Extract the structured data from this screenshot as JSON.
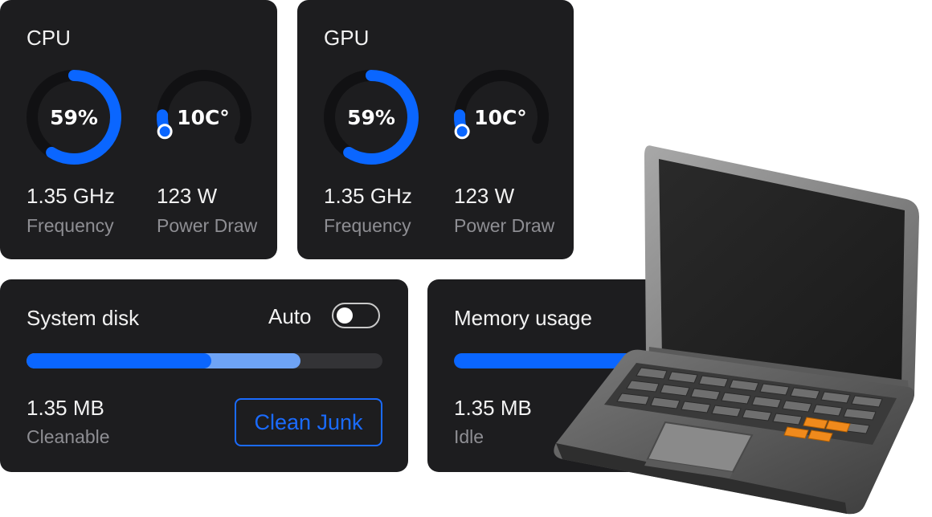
{
  "colors": {
    "accent": "#0a66ff",
    "accent_light": "#6ea3f5",
    "card_bg": "#1d1d1f",
    "track": "#111113"
  },
  "cpu": {
    "title": "CPU",
    "usage_label": "59%",
    "usage_value": 0.59,
    "temp_label": "10C°",
    "temp_level": 0.1,
    "frequency_value": "1.35 GHz",
    "frequency_label": "Frequency",
    "power_value": "123 W",
    "power_label": "Power Draw"
  },
  "gpu": {
    "title": "GPU",
    "usage_label": "59%",
    "usage_value": 0.59,
    "temp_label": "10C°",
    "temp_level": 0.1,
    "frequency_value": "1.35 GHz",
    "frequency_label": "Frequency",
    "power_value": "123 W",
    "power_label": "Power Draw"
  },
  "disk": {
    "title": "System disk",
    "auto_label": "Auto",
    "auto_enabled": false,
    "used_fraction": 0.52,
    "cleanable_fraction": 0.77,
    "size_value": "1.35 MB",
    "size_label": "Cleanable",
    "clean_button": "Clean Junk"
  },
  "memory": {
    "title": "Memory usage",
    "used_fraction": 0.55,
    "size_value": "1.35 MB",
    "size_label": "Idle"
  },
  "illustration": {
    "name": "laptop-illustration"
  }
}
